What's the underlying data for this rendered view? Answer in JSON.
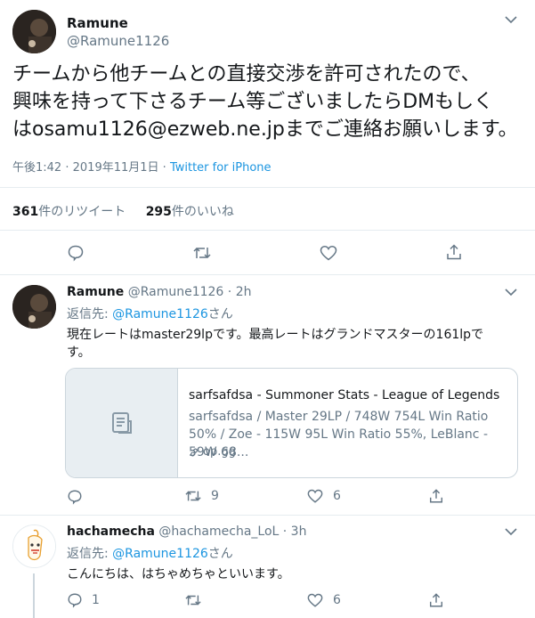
{
  "main_tweet": {
    "display_name": "Ramune",
    "handle": "@Ramune1126",
    "text_lines": [
      "チームから他チームとの直接交渉を許可されたので、",
      "興味を持って下さるチーム等ございましたらDMもしく",
      "はosamu1126@ezweb.ne.jpまでご連絡お願いします。"
    ],
    "time": "午後1:42",
    "date": "2019年11月1日",
    "separator": "·",
    "source": "Twitter for iPhone",
    "retweet_count": "361",
    "retweet_label": "件のリツイート",
    "like_count": "295",
    "like_label": "件のいいね"
  },
  "reply1": {
    "display_name": "Ramune",
    "handle": "@Ramune1126",
    "dot": "·",
    "time_ago": "2h",
    "reply_to_prefix": "返信先: ",
    "reply_to_handle": "@Ramune1126",
    "reply_to_suffix": "さん",
    "text_line1": "現在レートはmaster29lpです。最高レートはグランドマスターの161lpで",
    "text_line2": "す。",
    "card": {
      "title": "sarfsafdsa - Summoner Stats - League of Legends",
      "description": "sarfsafdsa / Master 29LP / 748W 754L Win Ratio 50% / Zoe - 115W 95L Win Ratio 55%, LeBlanc - 59W 68...",
      "domain": "op.gg"
    },
    "retweets": "9",
    "likes": "6"
  },
  "reply2": {
    "display_name": "hachamecha",
    "handle": "@hachamecha_LoL",
    "dot": "·",
    "time_ago": "3h",
    "reply_to_prefix": "返信先: ",
    "reply_to_handle": "@Ramune1126",
    "reply_to_suffix": "さん",
    "text": "こんにちは、はちゃめちゃといいます。",
    "replies": "1",
    "likes": "6"
  },
  "colors": {
    "link": "#1b95e0",
    "muted": "#657786",
    "divider": "#e6ecf0"
  }
}
